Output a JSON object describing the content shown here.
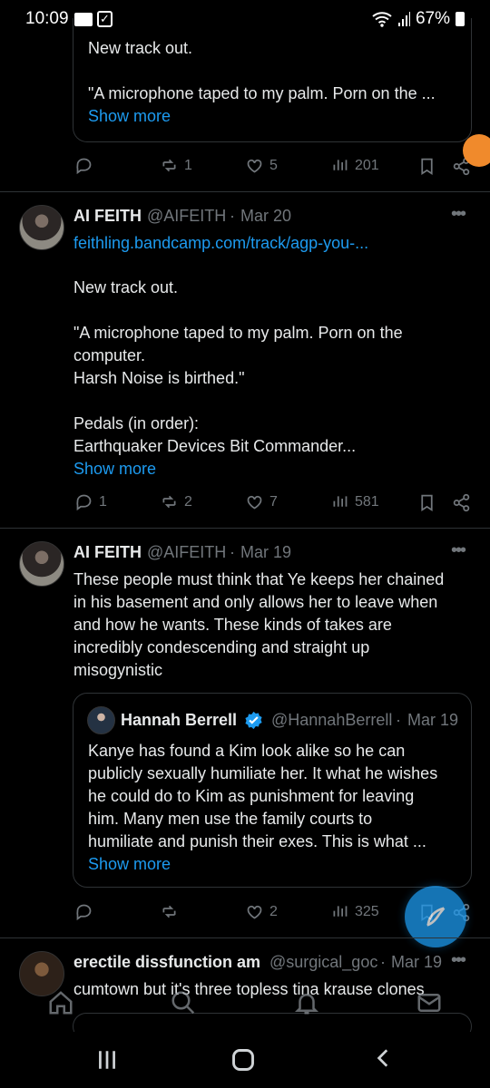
{
  "status_bar": {
    "time": "10:09",
    "battery": "67%"
  },
  "posts": [
    {
      "quote_text_1": "New track out.",
      "quote_text_2": "\"A microphone taped to my palm. Porn on the ...",
      "show_more": "Show more",
      "actions": {
        "replies": "",
        "reposts": "1",
        "likes": "5",
        "views": "201"
      }
    },
    {
      "author": "AI FEITH",
      "handle": "@AIFEITH",
      "separator": "·",
      "date": "Mar 20",
      "link": "feithling.bandcamp.com/track/agp-you-...",
      "text_1": "New track out.",
      "text_2": "\"A microphone taped to my palm. Porn on the",
      "text_3": "computer.",
      "text_4": "Harsh Noise is birthed.\"",
      "text_5": "Pedals (in order):",
      "text_6": "Earthquaker Devices Bit Commander...",
      "show_more": "Show more",
      "actions": {
        "replies": "1",
        "reposts": "2",
        "likes": "7",
        "views": "581"
      }
    },
    {
      "author": "AI FEITH",
      "handle": "@AIFEITH",
      "separator": "·",
      "date": "Mar 19",
      "text_1": "These people must think that Ye keeps her chained",
      "text_2": "in his basement and only allows her to leave when",
      "text_3": "and how he wants. These kinds of takes are",
      "text_4": "incredibly condescending and straight up",
      "text_5": "misogynistic",
      "quote": {
        "author": "Hannah Berrell",
        "handle": "@HannahBerrell",
        "separator": "·",
        "date": "Mar 19",
        "line_1": "Kanye has found a Kim look alike so he can",
        "line_2": "publicly sexually humiliate her. It what he wishes",
        "line_3": "he could do to Kim as punishment for leaving",
        "line_4": "him. Many men use the family courts to",
        "line_5": "humiliate and punish their exes. This is what ...",
        "show_more": "Show more"
      },
      "actions": {
        "replies": "",
        "reposts": "",
        "likes": "2",
        "views": "325"
      }
    },
    {
      "author": "erectile dissfunction am",
      "handle": "@surgical_goc",
      "separator": "·",
      "date": "Mar 19",
      "text_1": "cumtown but it's three topless tina krause clones"
    }
  ],
  "colors": {
    "background": "#000000",
    "text": "#e7e9ea",
    "muted": "#71767b",
    "link": "#1d9bf0",
    "divider": "#2f3336",
    "verified": "#1d9bf0"
  },
  "icons": {
    "reply": "reply-icon",
    "repost": "repost-icon",
    "like": "like-icon",
    "views": "views-icon",
    "bookmark": "bookmark-icon",
    "share": "share-icon",
    "more": "more-icon",
    "compose": "compose-icon",
    "home": "home-icon",
    "search": "search-icon",
    "notifications": "notifications-icon",
    "messages": "messages-icon"
  }
}
